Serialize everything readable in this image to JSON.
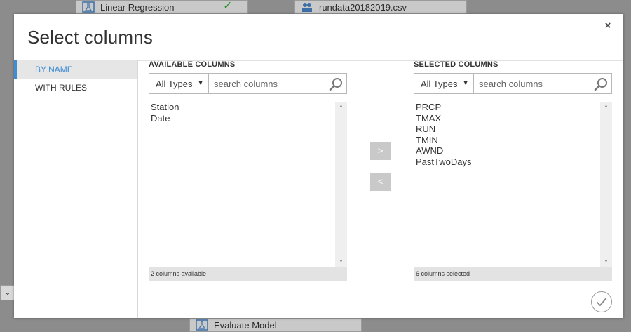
{
  "background": {
    "node_top_left": "Linear Regression",
    "node_top_right": "rundata20182019.csv",
    "node_bottom": "Evaluate Model",
    "left_control_glyph": "⌄"
  },
  "dialog": {
    "title": "Select columns",
    "close_glyph": "×"
  },
  "nav": {
    "items": [
      {
        "label": "BY NAME",
        "active": true
      },
      {
        "label": "WITH RULES",
        "active": false
      }
    ]
  },
  "available": {
    "heading": "AVAILABLE COLUMNS",
    "type_filter": "All Types",
    "search_placeholder": "search columns",
    "items": [
      "Station",
      "Date"
    ],
    "status": "2 columns available"
  },
  "selected": {
    "heading": "SELECTED COLUMNS",
    "type_filter": "All Types",
    "search_placeholder": "search columns",
    "items": [
      "PRCP",
      "TMAX",
      "RUN",
      "TMIN",
      "AWND",
      "PastTwoDays"
    ],
    "status": "6 columns selected"
  },
  "transfer": {
    "add_label": ">",
    "remove_label": "<"
  },
  "icons": {
    "search": "search-icon",
    "close": "close-icon",
    "confirm": "checkmark-icon",
    "dropdown": "chevron-down-icon"
  },
  "colors": {
    "accent": "#3c8dd3",
    "success_check": "#2f8f2f"
  }
}
